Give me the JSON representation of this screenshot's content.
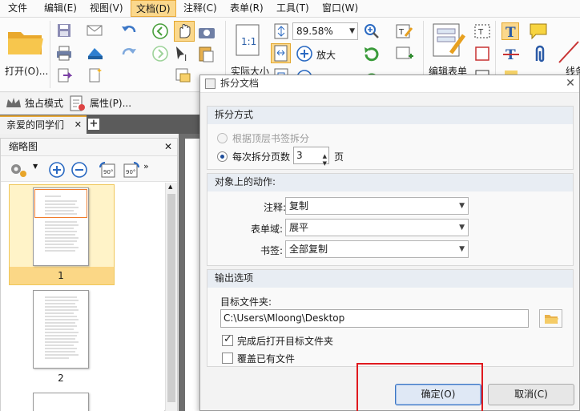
{
  "menubar": {
    "items": [
      "文件",
      "编辑(E)",
      "视图(V)",
      "文档(D)",
      "注释(C)",
      "表单(R)",
      "工具(T)",
      "窗口(W)"
    ],
    "active": "文档(D)"
  },
  "ribbon": {
    "open_label": "打开(O)...",
    "zoom_value": "89.58%",
    "actual_size_label": "实际大小",
    "zoom_in_label": "放大",
    "edit_form_label": "编辑表单",
    "line_label": "线条"
  },
  "subbar": {
    "exclusive_label": "独占模式",
    "properties_label": "属性(P)..."
  },
  "doctab": {
    "label": "亲爱的同学们"
  },
  "thumbnails": {
    "title": "缩略图",
    "pages": [
      "1",
      "2"
    ]
  },
  "dialog": {
    "title": "拆分文档",
    "split_group": {
      "heading": "拆分方式",
      "option_bookmark": "根据顶层书签拆分",
      "option_pages": "每次拆分页数",
      "pages_value": "3",
      "pages_unit": "页"
    },
    "action_group": {
      "heading": "对象上的动作:",
      "annotation_label": "注释:",
      "annotation_value": "复制",
      "formfield_label": "表单域:",
      "formfield_value": "展平",
      "bookmark_label": "书签:",
      "bookmark_value": "全部复制"
    },
    "output_group": {
      "heading": "输出选项",
      "folder_label": "目标文件夹:",
      "folder_value": "C:\\Users\\Mloong\\Desktop",
      "open_after_label": "完成后打开目标文件夹",
      "open_after_checked": true,
      "overwrite_label": "覆盖已有文件",
      "overwrite_checked": false
    },
    "ok_label": "确定(O)",
    "cancel_label": "取消(C)"
  },
  "colors": {
    "accent": "#fbd88c",
    "highlight_box": "#e0191e",
    "group_header": "#e8edf3"
  }
}
